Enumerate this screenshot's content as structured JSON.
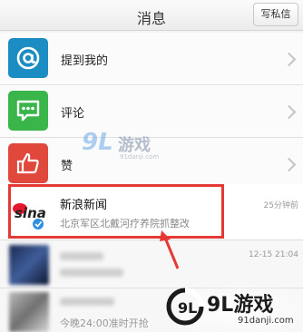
{
  "header": {
    "title": "消息",
    "compose_label": "写私信"
  },
  "menu": [
    {
      "label": "提到我的",
      "icon": "at-icon",
      "color": "#1c8dc2"
    },
    {
      "label": "评论",
      "icon": "comment-bubble-icon",
      "color": "#39b54a"
    },
    {
      "label": "赞",
      "icon": "thumbs-up-icon",
      "color": "#e0483b"
    }
  ],
  "news_item": {
    "title": "新浪新闻",
    "preview": "北京军区北戴河疗养院抓整改",
    "time": "25分钟前",
    "avatar_logo_text": "sina"
  },
  "blurred_items": [
    {
      "time": "12-15 21:04",
      "preview": ""
    },
    {
      "time": "",
      "preview": "今晚24:00准时开抢"
    }
  ],
  "watermark": {
    "brand": "游戏",
    "logo": "9L",
    "url": "91danji.com"
  },
  "colors": {
    "highlight": "#e53935",
    "verified_badge": "#2f8fe0"
  }
}
